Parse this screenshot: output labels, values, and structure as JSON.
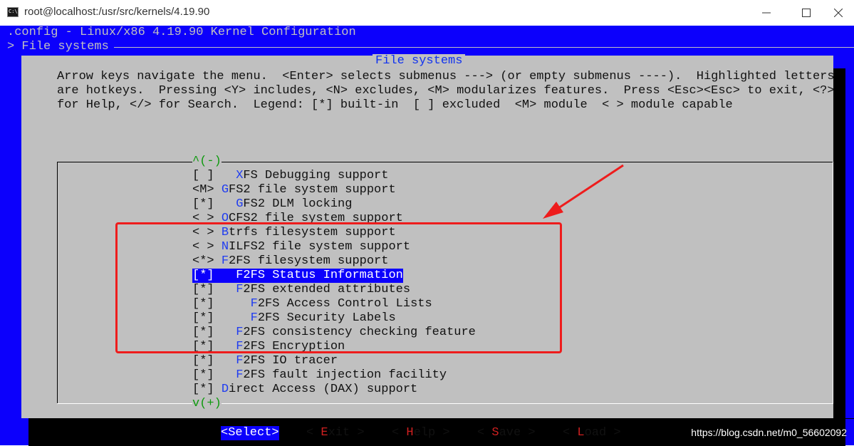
{
  "window": {
    "title": "root@localhost:/usr/src/kernels/4.19.90",
    "app_icon_text": "C:\\",
    "controls": [
      "minimize",
      "maximize",
      "close"
    ]
  },
  "terminal": {
    "header_line1": ".config - Linux/x86 4.19.90 Kernel Configuration",
    "header_line2": "> File systems"
  },
  "dialog": {
    "title": "File systems",
    "help_lines": [
      "Arrow keys navigate the menu.  <Enter> selects submenus ---> (or empty submenus ----).  Highlighted letters",
      "are hotkeys.  Pressing <Y> includes, <N> excludes, <M> modularizes features.  Press <Esc><Esc> to exit, <?>",
      "for Help, </> for Search.  Legend: [*] built-in  [ ] excluded  <M> module  < > module capable"
    ],
    "scroll_up": "^(-)",
    "scroll_down": "v(+)",
    "menu_items": [
      {
        "prefix": "[ ]   ",
        "hotkey": "X",
        "rest": "FS Debugging support"
      },
      {
        "prefix": "<M> ",
        "hotkey": "G",
        "rest": "FS2 file system support"
      },
      {
        "prefix": "[*]   ",
        "hotkey": "G",
        "rest": "FS2 DLM locking"
      },
      {
        "prefix": "< > ",
        "hotkey": "O",
        "rest": "CFS2 file system support"
      },
      {
        "prefix": "< > ",
        "hotkey": "B",
        "rest": "trfs filesystem support"
      },
      {
        "prefix": "< > ",
        "hotkey": "N",
        "rest": "ILFS2 file system support"
      },
      {
        "prefix": "<*> ",
        "hotkey": "F",
        "rest": "2FS filesystem support"
      },
      {
        "prefix": "[*]   ",
        "hotkey": "F",
        "rest": "2FS Status Information",
        "selected": true
      },
      {
        "prefix": "[*]   ",
        "hotkey": "F",
        "rest": "2FS extended attributes"
      },
      {
        "prefix": "[*]     ",
        "hotkey": "F",
        "rest": "2FS Access Control Lists"
      },
      {
        "prefix": "[*]     ",
        "hotkey": "F",
        "rest": "2FS Security Labels"
      },
      {
        "prefix": "[*]   ",
        "hotkey": "F",
        "rest": "2FS consistency checking feature"
      },
      {
        "prefix": "[*]   ",
        "hotkey": "F",
        "rest": "2FS Encryption"
      },
      {
        "prefix": "[*]   ",
        "hotkey": "F",
        "rest": "2FS IO tracer"
      },
      {
        "prefix": "[*]   ",
        "hotkey": "F",
        "rest": "2FS fault injection facility"
      },
      {
        "prefix": "[*] ",
        "hotkey": "D",
        "rest": "irect Access (DAX) support"
      }
    ],
    "buttons": [
      {
        "open": "<",
        "hotkey": "S",
        "rest": "elect",
        "close": ">",
        "selected": true
      },
      {
        "open": "< ",
        "hotkey": "E",
        "rest": "xit",
        "close": " >"
      },
      {
        "open": "< ",
        "hotkey": "H",
        "rest": "elp",
        "close": " >"
      },
      {
        "open": "< ",
        "hotkey": "S",
        "rest": "ave",
        "close": " >"
      },
      {
        "open": "< ",
        "hotkey": "L",
        "rest": "oad",
        "close": " >"
      }
    ]
  },
  "annotation": {
    "color": "#ee1c1c"
  },
  "watermark": "https://blog.csdn.net/m0_56602092"
}
